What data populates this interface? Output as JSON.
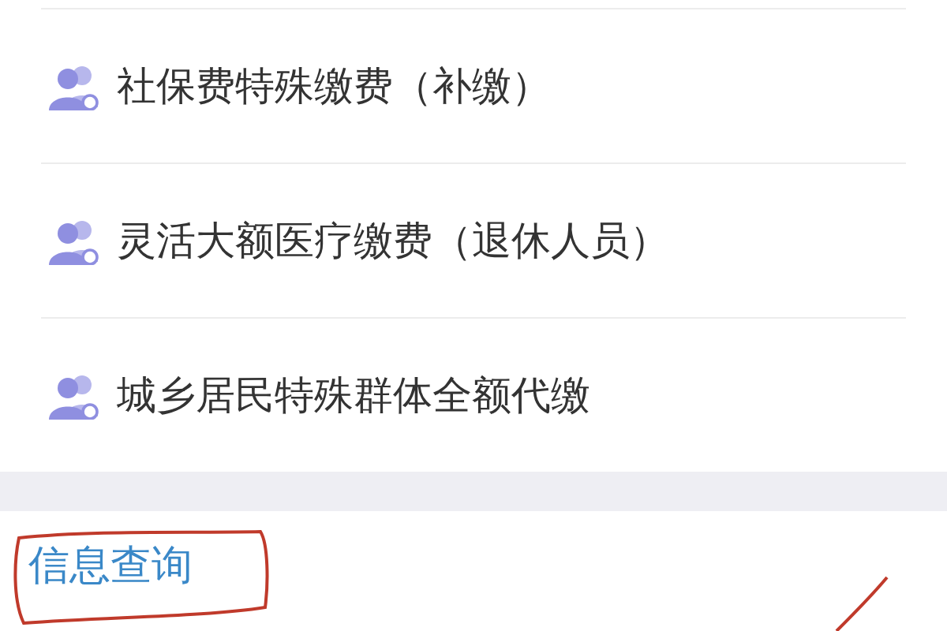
{
  "services": [
    {
      "label": "社保费特殊缴费（补缴）"
    },
    {
      "label": "灵活大额医疗缴费（退休人员）"
    },
    {
      "label": "城乡居民特殊群体全额代缴"
    }
  ],
  "section": {
    "title": "信息查询"
  }
}
